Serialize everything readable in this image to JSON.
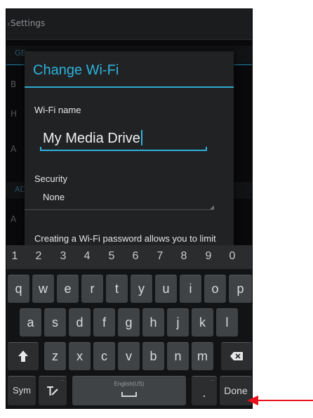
{
  "settings_bg": {
    "title": "Settings",
    "section1": "GE",
    "row_b": "B",
    "row_h": "H",
    "row_a": "A",
    "section2": "AD",
    "row_a2": "A"
  },
  "dialog": {
    "title": "Change Wi-Fi",
    "wifi_name_label": "Wi-Fi name",
    "wifi_name_value": "My Media Drive",
    "security_label": "Security",
    "security_value": "None",
    "message": "Creating a Wi-Fi password allows you to limit access to your Drive when"
  },
  "keyboard": {
    "numbers": [
      "1",
      "2",
      "3",
      "4",
      "5",
      "6",
      "7",
      "8",
      "9",
      "0"
    ],
    "row1": [
      "q",
      "w",
      "e",
      "r",
      "t",
      "y",
      "u",
      "i",
      "o",
      "p"
    ],
    "row2": [
      "a",
      "s",
      "d",
      "f",
      "g",
      "h",
      "j",
      "k",
      "l"
    ],
    "row3": [
      "z",
      "x",
      "c",
      "v",
      "b",
      "n",
      "m"
    ],
    "shift_icon": "shift-arrow-icon",
    "backspace_icon": "backspace-icon",
    "sym_label": "Sym",
    "voice_icon": "handwriting-icon",
    "space_label": "English(US)",
    "period_label": ".",
    "done_label": "Done"
  },
  "annotation": {
    "arrow_color": "#e8101a"
  }
}
